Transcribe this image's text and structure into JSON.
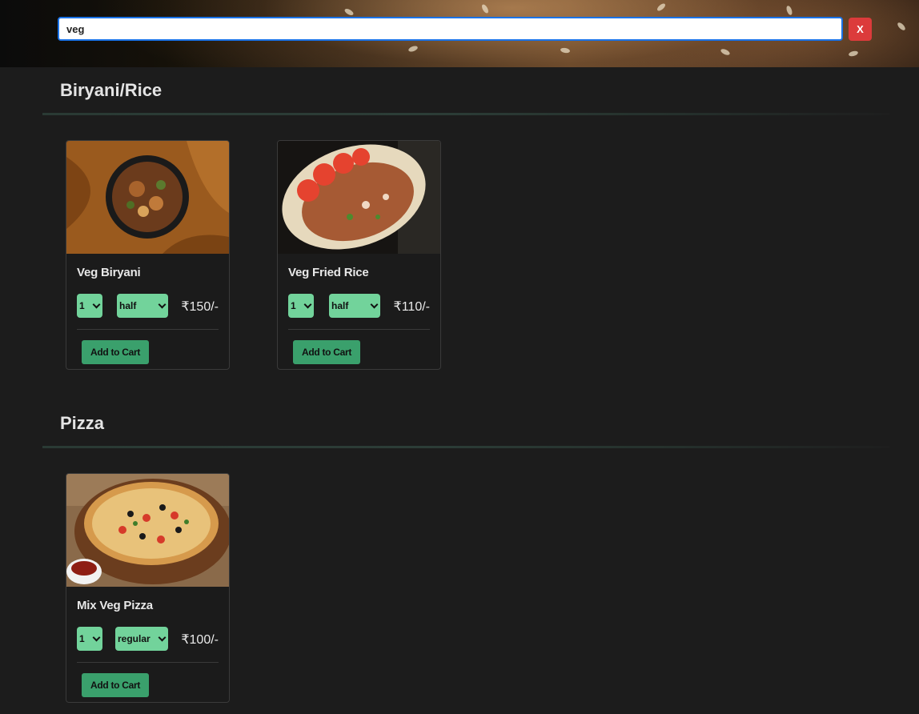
{
  "search": {
    "value": "veg",
    "clear_label": "X"
  },
  "categories": [
    {
      "title": "Biryani/Rice",
      "items": [
        {
          "name": "Veg Biryani",
          "qty": "1",
          "size": "half",
          "price": "₹150/-",
          "add_label": "Add to Cart"
        },
        {
          "name": "Veg Fried Rice",
          "qty": "1",
          "size": "half",
          "price": "₹110/-",
          "add_label": "Add to Cart"
        }
      ]
    },
    {
      "title": "Pizza",
      "items": [
        {
          "name": "Mix Veg Pizza",
          "qty": "1",
          "size": "regular",
          "price": "₹100/-",
          "add_label": "Add to Cart"
        }
      ]
    }
  ],
  "colors": {
    "background": "#1c1c1c",
    "select_bg": "#72d39b",
    "button_bg": "#3aa06c",
    "clear_bg": "#dc3b3b"
  }
}
